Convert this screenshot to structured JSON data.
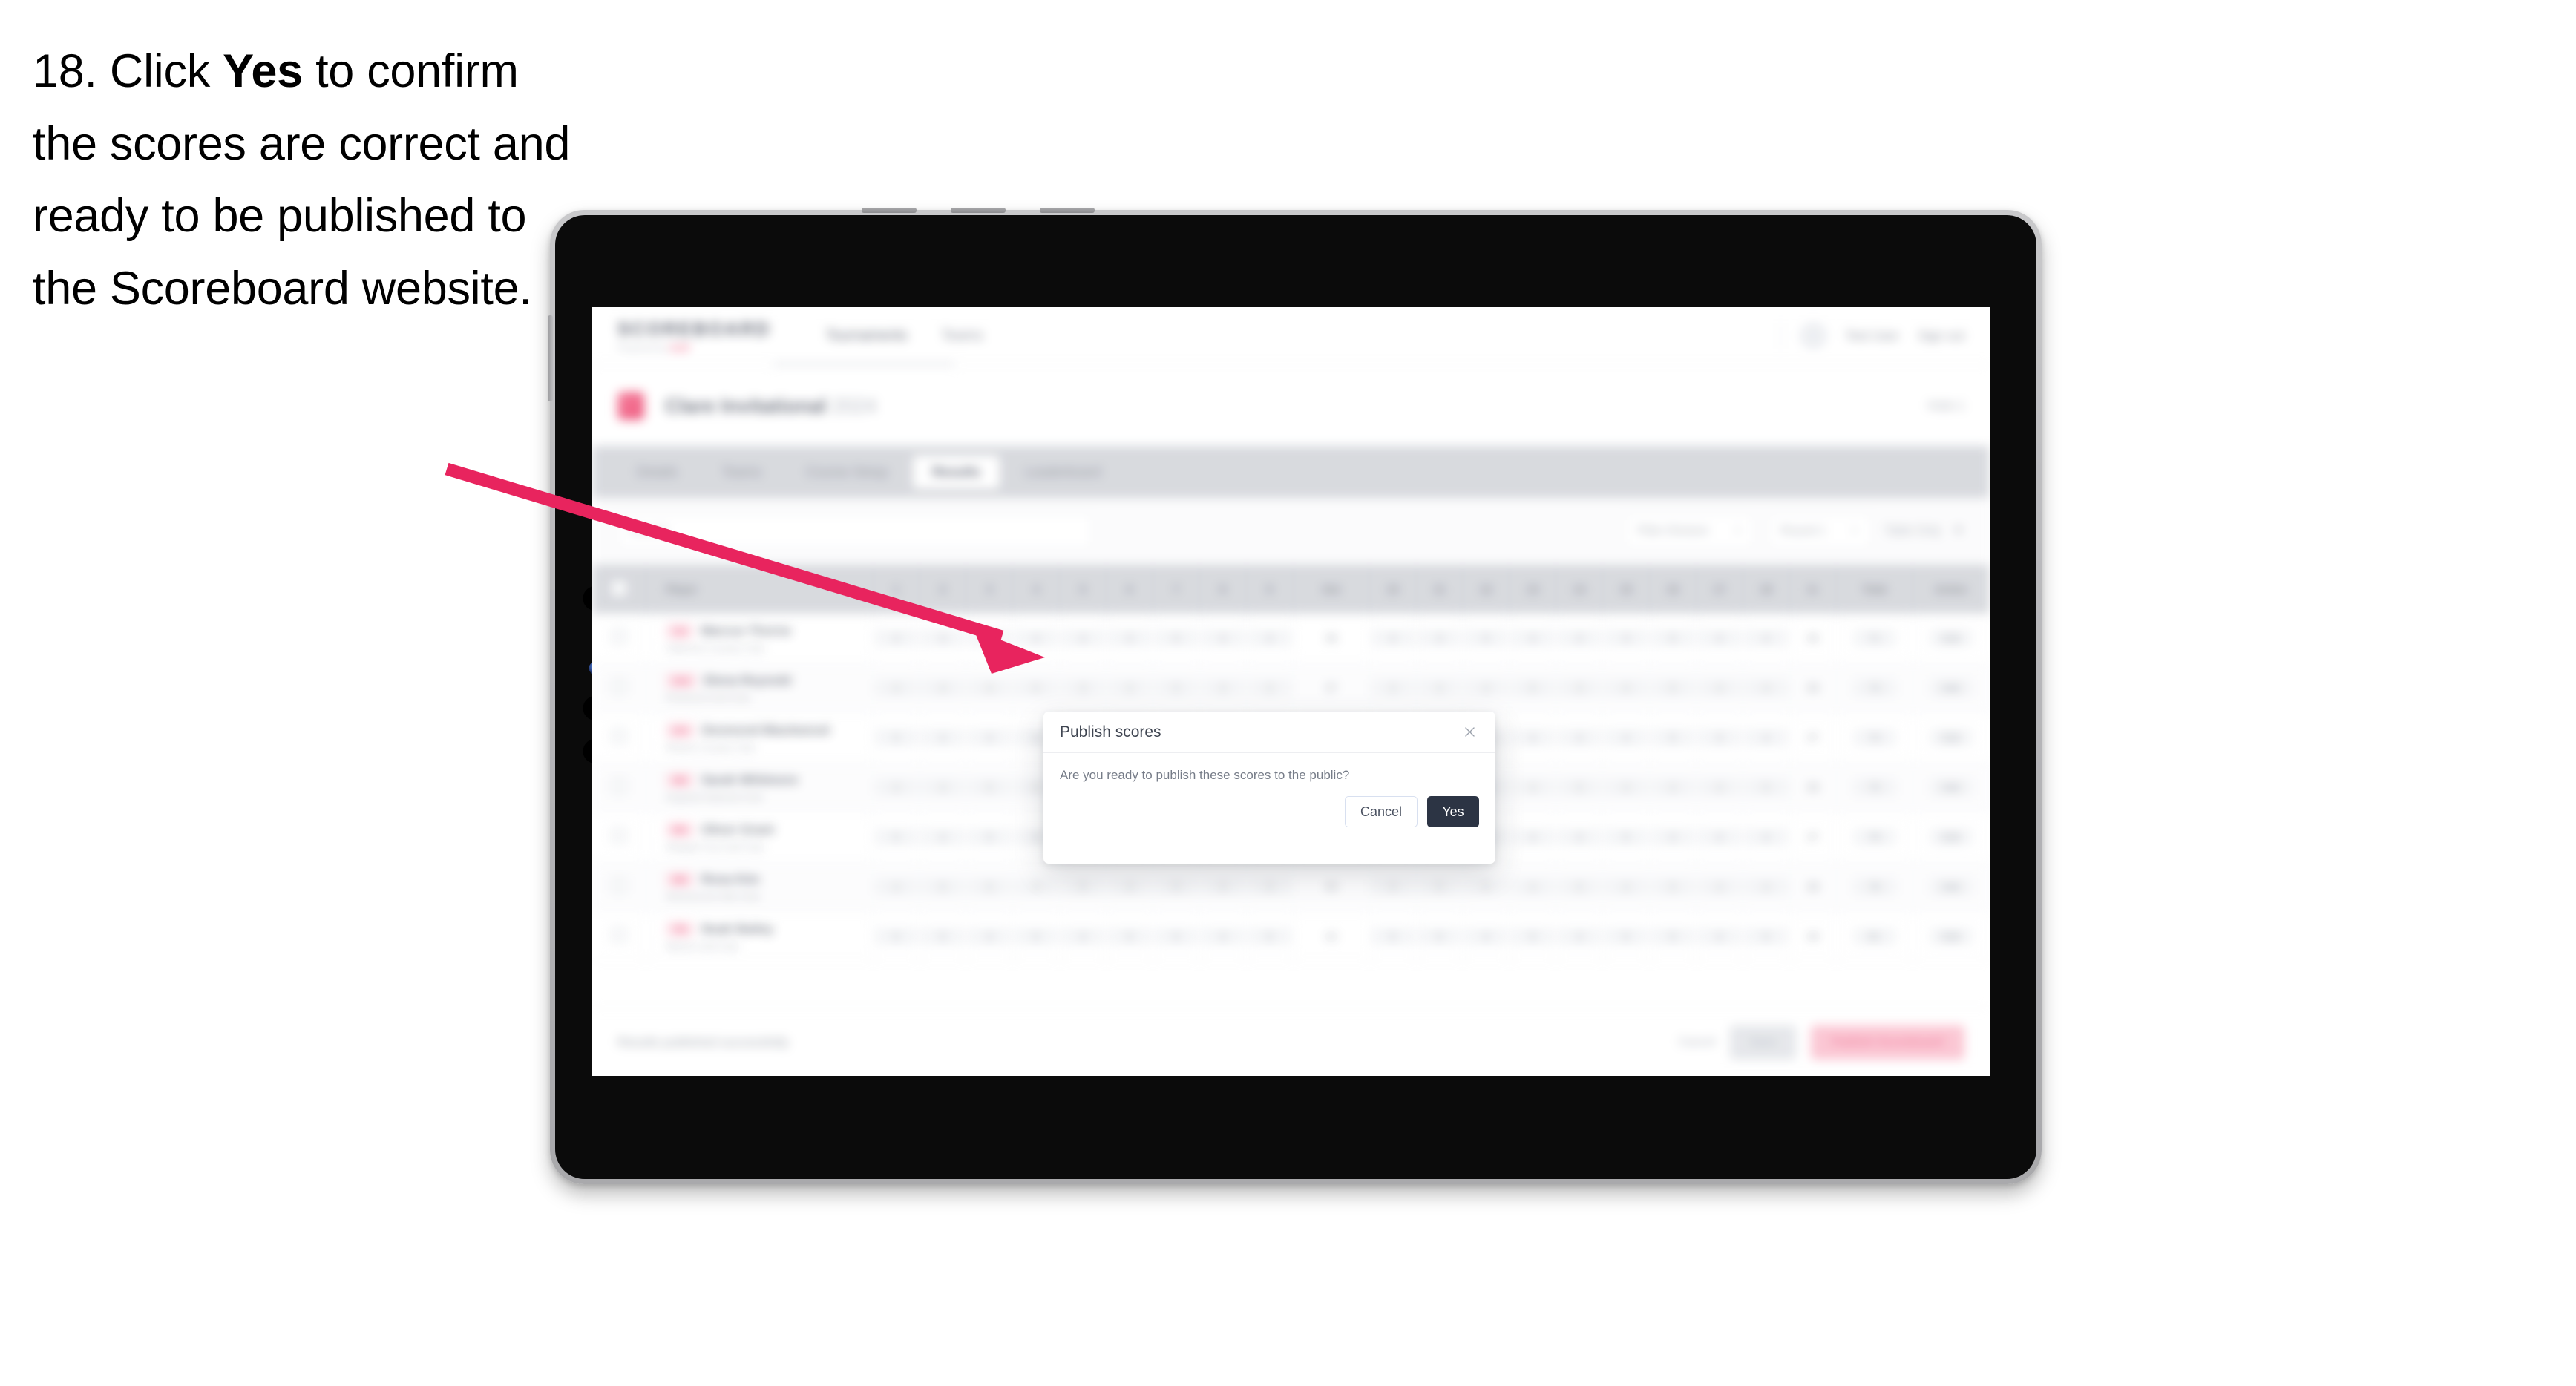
{
  "instruction": {
    "step_number": "18.",
    "text_before": "Click",
    "bold_word": "Yes",
    "text_after": "to confirm the scores are correct and ready to be published to the Scoreboard website."
  },
  "callout": {
    "arrow_color": "#e8245e",
    "arrow_name": "pink-pointer-arrow",
    "points_to": "Yes"
  },
  "device": {
    "type": "tablet",
    "frame_color": "#b9b9bc",
    "bezel_color": "#0b0b0b"
  },
  "app": {
    "topbar": {
      "brand_title": "SCOREBOARD",
      "brand_sub": "Powered by",
      "brand_sub_accent": "Golf",
      "nav_links": [
        "Tournaments",
        "Teams"
      ],
      "user_name": "Test User",
      "sign_out": "Sign out",
      "avatar_name": "user-avatar"
    },
    "event": {
      "title_main": "Clare Invitational",
      "title_light": "2024",
      "right_label": "Hole 1"
    },
    "tabs": [
      {
        "label": "Details",
        "active": false
      },
      {
        "label": "Teams",
        "active": false
      },
      {
        "label": "Course Setup",
        "active": false
      },
      {
        "label": "Results",
        "active": true
      },
      {
        "label": "Leaderboard",
        "active": false
      }
    ],
    "filters": {
      "search_placeholder": "Search",
      "select_1": "Filter Division",
      "select_2": "Round 1",
      "select_3": "Table Only"
    },
    "table": {
      "columns": [
        "Player",
        "1",
        "2",
        "3",
        "4",
        "5",
        "6",
        "7",
        "8",
        "9",
        "Out",
        "10",
        "11",
        "12",
        "13",
        "14",
        "15",
        "16",
        "17",
        "18",
        "In",
        "Total",
        "Action"
      ],
      "rows": [
        {
          "rank": "1st",
          "name": "Marcus Thorne",
          "club": "Oakmont Country Club",
          "scores": [
            "4",
            "3",
            "5",
            "4",
            "4",
            "3",
            "5",
            "4",
            "4"
          ],
          "out": "36",
          "in": "35",
          "total": "71",
          "action": "Edit"
        },
        {
          "rank": "2nd",
          "name": "Elena Reynold",
          "club": "Pinehurst Golf Club",
          "scores": [
            "4",
            "4",
            "4",
            "5",
            "3",
            "4",
            "5",
            "4",
            "4"
          ],
          "out": "37",
          "in": "36",
          "total": "73",
          "action": "Edit"
        },
        {
          "rank": "3rd",
          "name": "Desmond Blackwood",
          "club": "Riviera Country Club",
          "scores": [
            "5",
            "4",
            "4",
            "4",
            "4",
            "4",
            "5",
            "3",
            "4"
          ],
          "out": "37",
          "in": "37",
          "total": "74",
          "action": "Edit"
        },
        {
          "rank": "4th",
          "name": "Sarah Whitmore",
          "club": "Augusta National Club",
          "scores": [
            "4",
            "4",
            "5",
            "4",
            "5",
            "4",
            "4",
            "4",
            "5"
          ],
          "out": "39",
          "in": "36",
          "total": "75",
          "action": "Edit"
        },
        {
          "rank": "5th",
          "name": "Oliver Grant",
          "club": "Winged Foot Golf Club",
          "scores": [
            "5",
            "4",
            "5",
            "4",
            "4",
            "5",
            "4",
            "4",
            "4"
          ],
          "out": "39",
          "in": "37",
          "total": "76",
          "action": "Edit"
        },
        {
          "rank": "6th",
          "name": "Rosa Kim",
          "club": "Shinnecock Hills Club",
          "scores": [
            "4",
            "5",
            "5",
            "4",
            "5",
            "4",
            "5",
            "4",
            "4"
          ],
          "out": "40",
          "in": "38",
          "total": "78",
          "action": "Edit"
        },
        {
          "rank": "7th",
          "name": "Noah Bailey",
          "club": "Merion Golf Club",
          "scores": [
            "5",
            "5",
            "4",
            "5",
            "4",
            "5",
            "5",
            "4",
            "5"
          ],
          "out": "42",
          "in": "39",
          "total": "81",
          "action": "Edit"
        }
      ]
    },
    "footer": {
      "note": "Results published successfully",
      "link": "Cancel",
      "grey_button": "Save",
      "pink_button": "Publish Scoreboard"
    }
  },
  "modal": {
    "title": "Publish scores",
    "body_text": "Are you ready to publish these scores to the public?",
    "cancel_label": "Cancel",
    "confirm_label": "Yes",
    "close_icon": "close-x-icon",
    "confirm_color": "#2c3444"
  }
}
